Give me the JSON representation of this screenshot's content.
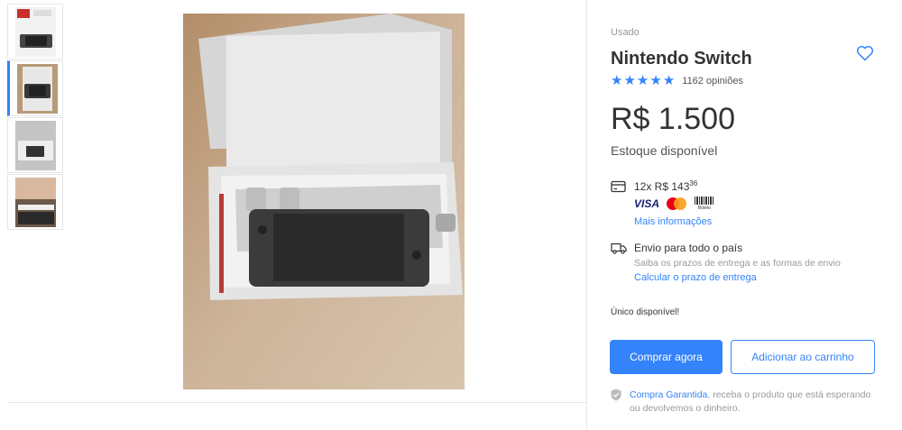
{
  "product": {
    "condition": "Usado",
    "title": "Nintendo Switch",
    "reviews_count": "1162 opiniões",
    "rating_stars": 5,
    "price": "R$ 1.500",
    "stock": "Estoque disponível"
  },
  "payment": {
    "installments_main": "12x R$ 143",
    "installments_cents": "36",
    "visa_label": "VISA",
    "boleto_label": "Boleto",
    "more_info": "Mais informações"
  },
  "shipping": {
    "title": "Envio para todo o país",
    "subtitle": "Saiba os prazos de entrega e as formas de envio",
    "link": "Calcular o prazo de entrega"
  },
  "availability": "Único disponível!",
  "actions": {
    "buy_now": "Comprar agora",
    "add_to_cart": "Adicionar ao carrinho"
  },
  "guarantee": {
    "link": "Compra Garantida",
    "text": ", receba o produto que está esperando ou devolvemos o dinheiro."
  },
  "gallery": {
    "active_index": 1
  },
  "colors": {
    "accent": "#3483fa",
    "mastercard_red": "#eb001b",
    "mastercard_yellow": "#f79e1b"
  },
  "icons": [
    "heart-icon",
    "star-icon",
    "credit-card-icon",
    "truck-icon",
    "shield-icon"
  ]
}
